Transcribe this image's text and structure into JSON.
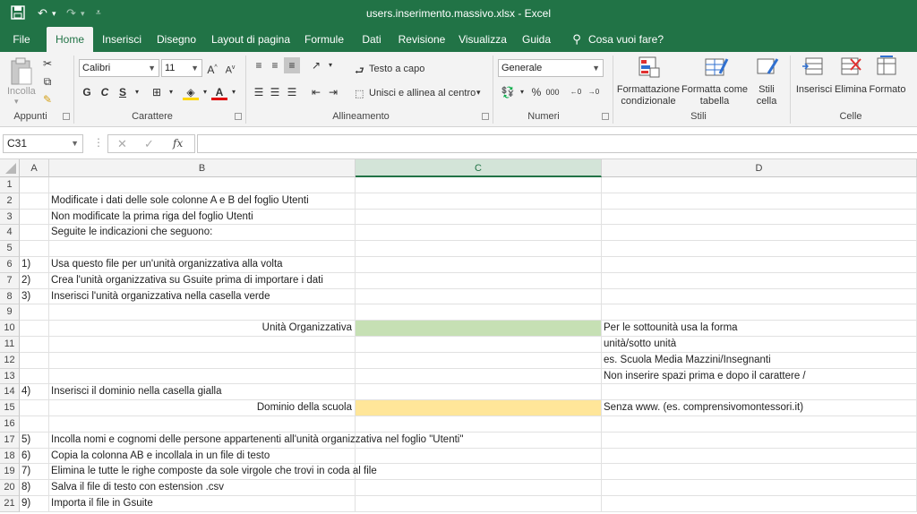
{
  "window": {
    "title": "users.inserimento.massivo.xlsx  -  Excel"
  },
  "tabs": [
    "File",
    "Home",
    "Inserisci",
    "Disegno",
    "Layout di pagina",
    "Formule",
    "Dati",
    "Revisione",
    "Visualizza",
    "Guida"
  ],
  "tell_me": "Cosa vuoi fare?",
  "ribbon": {
    "clipboard": {
      "paste_label": "Incolla",
      "group": "Appunti"
    },
    "font": {
      "name": "Calibri",
      "size": "11",
      "bold": "G",
      "italic": "C",
      "underline": "S",
      "group": "Carattere"
    },
    "alignment": {
      "wrap": "Testo a capo",
      "merge": "Unisci e allinea al centro",
      "group": "Allineamento"
    },
    "number": {
      "format": "Generale",
      "percent": "%",
      "thousands": "000",
      "group": "Numeri"
    },
    "styles": {
      "conditional": "Formattazione condizionale",
      "table": "Formatta come tabella",
      "cell": "Stili cella",
      "group": "Stili"
    },
    "cells": {
      "insert": "Inserisci",
      "delete": "Elimina",
      "format": "Formato",
      "group": "Celle"
    }
  },
  "formula_bar": {
    "name_box": "C31",
    "fx": "fx",
    "value": ""
  },
  "columns": [
    "A",
    "B",
    "C",
    "D"
  ],
  "rows": [
    {
      "n": "1",
      "a": "",
      "b": "",
      "c": "",
      "d": ""
    },
    {
      "n": "2",
      "a": "",
      "b": "Modificate i dati delle sole colonne A e B del foglio Utenti",
      "c": "",
      "d": ""
    },
    {
      "n": "3",
      "a": "",
      "b": "Non modificate la prima riga del foglio Utenti",
      "c": "",
      "d": ""
    },
    {
      "n": "4",
      "a": "",
      "b": "Seguite le indicazioni che seguono:",
      "c": "",
      "d": ""
    },
    {
      "n": "5",
      "a": "",
      "b": "",
      "c": "",
      "d": ""
    },
    {
      "n": "6",
      "a": "1)",
      "b": "Usa questo file per un'unità organizzativa alla volta",
      "c": "",
      "d": ""
    },
    {
      "n": "7",
      "a": "2)",
      "b": "Crea l'unità organizzativa su Gsuite prima di importare i dati",
      "c": "",
      "d": ""
    },
    {
      "n": "8",
      "a": "3)",
      "b": "Inserisci l'unità organizzativa nella casella verde",
      "c": "",
      "d": ""
    },
    {
      "n": "9",
      "a": "",
      "b": "",
      "c": "",
      "d": ""
    },
    {
      "n": "10",
      "a": "",
      "b": "Unità Organizzativa",
      "c": "",
      "d": "Per le sottounità usa la forma",
      "b_align": "right",
      "c_fill": "green"
    },
    {
      "n": "11",
      "a": "",
      "b": "",
      "c": "",
      "d": "unità/sotto unità"
    },
    {
      "n": "12",
      "a": "",
      "b": "",
      "c": "",
      "d": "es. Scuola Media Mazzini/Insegnanti"
    },
    {
      "n": "13",
      "a": "",
      "b": "",
      "c": "",
      "d": "Non inserire spazi prima e dopo il carattere /"
    },
    {
      "n": "14",
      "a": "4)",
      "b": "Inserisci il dominio nella casella gialla",
      "c": "",
      "d": ""
    },
    {
      "n": "15",
      "a": "",
      "b": "Dominio della scuola",
      "c": "",
      "d": "Senza www. (es.  comprensivomontessori.it)",
      "b_align": "right",
      "c_fill": "yellow"
    },
    {
      "n": "16",
      "a": "",
      "b": "",
      "c": "",
      "d": ""
    },
    {
      "n": "17",
      "a": "5)",
      "b": "Incolla nomi e cognomi delle persone appartenenti all'unità organizzativa nel foglio \"Utenti\"",
      "c": "",
      "d": ""
    },
    {
      "n": "18",
      "a": "6)",
      "b": "Copia la colonna AB e incollala in un file di testo",
      "c": "",
      "d": ""
    },
    {
      "n": "19",
      "a": "7)",
      "b": "Elimina le tutte le righe composte da sole virgole che trovi in coda al file",
      "c": "",
      "d": ""
    },
    {
      "n": "20",
      "a": "8)",
      "b": "Salva il file di testo con estension .csv",
      "c": "",
      "d": ""
    },
    {
      "n": "21",
      "a": "9)",
      "b": "Importa il file in Gsuite",
      "c": "",
      "d": ""
    }
  ]
}
